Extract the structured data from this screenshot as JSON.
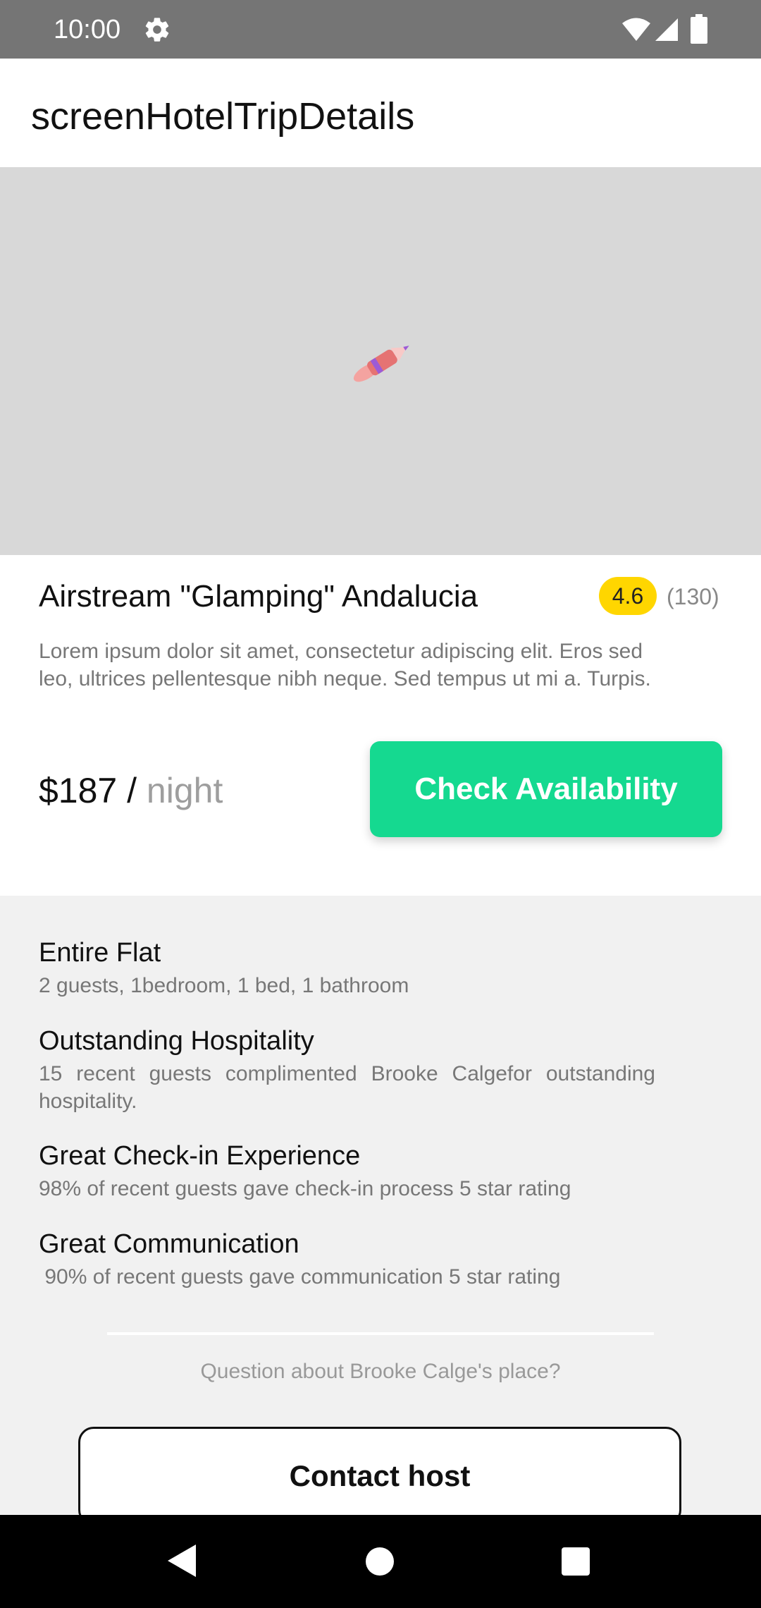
{
  "status_bar": {
    "time": "10:00",
    "icons": [
      "gear-icon",
      "wifi-icon",
      "signal-icon",
      "battery-icon"
    ]
  },
  "app_bar": {
    "title": "screenHotelTripDetails"
  },
  "hero": {
    "icon": "rocket-icon",
    "background_color": "#d8d8d8"
  },
  "listing": {
    "title": "Airstream \"Glamping\" Andalucia",
    "rating": "4.6",
    "review_count": "(130)",
    "description": "Lorem ipsum dolor sit amet, consectetur adipiscing elit. Eros sed leo, ultrices pellentesque nibh neque. Sed tempus ut mi a. Turpis.",
    "price": "$187 / ",
    "price_unit": "night",
    "check_button_label": "Check Availability"
  },
  "features": [
    {
      "title": "Entire Flat",
      "description": "2 guests, 1bedroom, 1 bed, 1 bathroom"
    },
    {
      "title": "Outstanding Hospitality",
      "description": "15 recent guests complimented Brooke Calgefor outstanding hospitality."
    },
    {
      "title": "Great Check-in Experience",
      "description": "98% of recent guests gave check-in process 5 star rating"
    },
    {
      "title": "Great Communication",
      "description": " 90% of recent guests gave communication 5 star rating"
    }
  ],
  "contact": {
    "question": "Question about Brooke Calge's place?",
    "button_label": "Contact host"
  },
  "nav_bar": {
    "icons": [
      "back-icon",
      "home-icon",
      "recent-apps-icon"
    ]
  },
  "colors": {
    "accent": "#15d990",
    "rating_badge": "#ffd600",
    "status_bar": "#757575",
    "section_background": "#f1f1f1"
  }
}
